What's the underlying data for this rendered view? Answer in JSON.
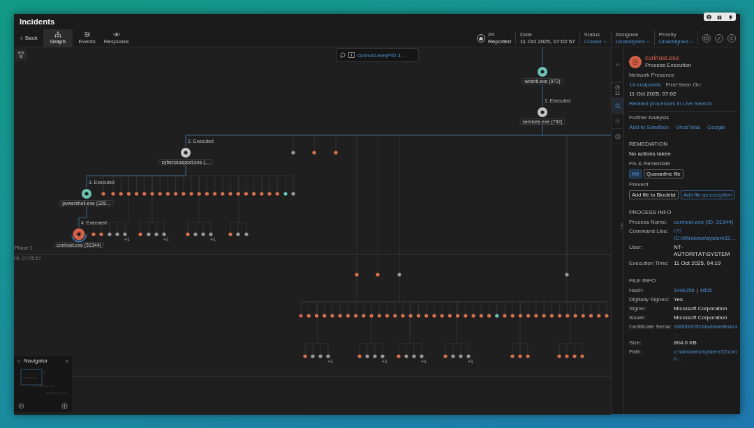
{
  "window": {
    "title": "Incidents"
  },
  "toolbar": {
    "back": "Back",
    "tabs": [
      {
        "label": "Graph",
        "selected": true
      },
      {
        "label": "Events",
        "selected": false
      },
      {
        "label": "Response",
        "selected": false
      }
    ]
  },
  "incident": {
    "number": "#9",
    "state": "Reported"
  },
  "fields": [
    {
      "label": "Date",
      "value": "11 Oct 2025, 07:02:57",
      "kind": "text"
    },
    {
      "label": "Status",
      "value": "Closed",
      "kind": "dropdown"
    },
    {
      "label": "Assignee",
      "value": "Unassigned",
      "kind": "dropdown"
    },
    {
      "label": "Priority",
      "value": "Unassigned",
      "kind": "dropdown"
    }
  ],
  "graph": {
    "search_link": "conhost.exe(PID 3…",
    "phase_label": "Phase 1",
    "timestamp": "05, 07:05:57",
    "navigator": "Navigator",
    "nodes": [
      {
        "label": "wininit.exe (972)",
        "color": "#6cc7b6",
        "selected": false
      },
      {
        "label": "services.exe (792)",
        "color": "#c9c9c9",
        "edge_label": "1. Executed",
        "selected": false
      },
      {
        "label": "cybercsuspect.exe (…",
        "color": "#c9c9c9",
        "edge_label": "2. Executed",
        "selected": false
      },
      {
        "label": "powershell.exe (328…",
        "color": "#6cc7b6",
        "edge_label": "3. Executed",
        "selected": false
      },
      {
        "label": "conhost.exe (31344)",
        "color": "#d3614a",
        "edge_label": "4. Executed",
        "selected": true
      }
    ],
    "dot_rows": [
      {
        "groups": [
          {
            "dots": [
              {
                "color": "#9b9b9b"
              },
              {
                "color": "#d9734e"
              },
              {
                "color": "#d9734e"
              }
            ]
          }
        ]
      },
      {
        "groups": [
          {
            "dots": [
              {
                "color": "#d9734e"
              },
              {
                "color": "#d9734e"
              },
              {
                "color": "#d9734e"
              },
              {
                "color": "#d9734e"
              },
              {
                "color": "#d9734e"
              },
              {
                "color": "#d9734e"
              },
              {
                "color": "#d9734e"
              },
              {
                "color": "#d9734e"
              },
              {
                "color": "#d9734e"
              },
              {
                "color": "#d9734e"
              },
              {
                "color": "#d9734e"
              },
              {
                "color": "#d9734e"
              },
              {
                "color": "#d9734e"
              },
              {
                "color": "#d9734e"
              },
              {
                "color": "#d9734e"
              },
              {
                "color": "#d9734e"
              },
              {
                "color": "#d9734e"
              },
              {
                "color": "#d9734e"
              },
              {
                "color": "#d9734e"
              },
              {
                "color": "#d9734e"
              },
              {
                "color": "#d9734e"
              },
              {
                "color": "#d9734e"
              },
              {
                "color": "#d9734e"
              },
              {
                "color": "#6cc7b6"
              },
              {
                "color": "#9b9b9b"
              }
            ]
          }
        ]
      },
      {
        "groups": [
          {
            "dots": [
              {
                "color": "#d9734e"
              },
              {
                "color": "#d9734e"
              },
              {
                "color": "#9b9b9b"
              },
              {
                "color": "#9b9b9b"
              },
              {
                "color": "#9b9b9b"
              }
            ],
            "more": "+1"
          },
          {
            "dots": [
              {
                "color": "#d9734e"
              },
              {
                "color": "#9b9b9b"
              },
              {
                "color": "#9b9b9b"
              },
              {
                "color": "#9b9b9b"
              }
            ],
            "more": "+1"
          },
          {
            "dots": [
              {
                "color": "#d9734e"
              },
              {
                "color": "#9b9b9b"
              },
              {
                "color": "#9b9b9b"
              },
              {
                "color": "#9b9b9b"
              }
            ],
            "more": "+1"
          },
          {
            "dots": [
              {
                "color": "#d9734e"
              },
              {
                "color": "#9b9b9b"
              },
              {
                "color": "#9b9b9b"
              }
            ]
          }
        ]
      },
      {
        "groups": [
          {
            "dots": [
              {
                "color": "#d9734e"
              },
              {
                "color": "#d9734e"
              },
              {
                "color": "#9b9b9b"
              },
              {
                "color": "#9b9b9b"
              }
            ]
          }
        ]
      },
      {
        "groups": [
          {
            "dots": [
              {
                "color": "#c8654a"
              },
              {
                "color": "#d9734e"
              },
              {
                "color": "#d9734e"
              },
              {
                "color": "#d9734e"
              },
              {
                "color": "#d9734e"
              },
              {
                "color": "#d9734e"
              },
              {
                "color": "#d9734e"
              },
              {
                "color": "#d9734e"
              },
              {
                "color": "#d9734e"
              },
              {
                "color": "#d9734e"
              },
              {
                "color": "#d9734e"
              },
              {
                "color": "#d9734e"
              },
              {
                "color": "#d9734e"
              },
              {
                "color": "#d9734e"
              },
              {
                "color": "#d9734e"
              },
              {
                "color": "#d9734e"
              },
              {
                "color": "#d9734e"
              },
              {
                "color": "#d9734e"
              },
              {
                "color": "#d9734e"
              },
              {
                "color": "#d9734e"
              },
              {
                "color": "#d9734e"
              },
              {
                "color": "#d9734e"
              },
              {
                "color": "#d9734e"
              },
              {
                "color": "#d9734e"
              },
              {
                "color": "#d9734e"
              },
              {
                "color": "#6cc7b6"
              },
              {
                "color": "#d9734e"
              },
              {
                "color": "#d9734e"
              },
              {
                "color": "#d9734e"
              },
              {
                "color": "#d9734e"
              },
              {
                "color": "#d9734e"
              },
              {
                "color": "#d9734e"
              },
              {
                "color": "#d9734e"
              },
              {
                "color": "#d9734e"
              },
              {
                "color": "#d9734e"
              },
              {
                "color": "#d9734e"
              },
              {
                "color": "#d9734e"
              },
              {
                "color": "#d9734e"
              },
              {
                "color": "#d9734e"
              },
              {
                "color": "#d9734e"
              }
            ]
          }
        ]
      },
      {
        "groups": [
          {
            "dots": [
              {
                "color": "#d9734e"
              },
              {
                "color": "#9b9b9b"
              },
              {
                "color": "#9b9b9b"
              },
              {
                "color": "#9b9b9b"
              }
            ],
            "more": "+1"
          },
          {
            "dots": [
              {
                "color": "#d9734e"
              },
              {
                "color": "#9b9b9b"
              },
              {
                "color": "#9b9b9b"
              },
              {
                "color": "#9b9b9b"
              }
            ],
            "more": "+1"
          },
          {
            "dots": [
              {
                "color": "#d9734e"
              },
              {
                "color": "#9b9b9b"
              },
              {
                "color": "#9b9b9b"
              },
              {
                "color": "#9b9b9b"
              }
            ],
            "more": "+1"
          },
          {
            "dots": [
              {
                "color": "#d9734e"
              },
              {
                "color": "#9b9b9b"
              },
              {
                "color": "#9b9b9b"
              },
              {
                "color": "#9b9b9b"
              }
            ],
            "more": "+1"
          },
          {
            "dots": [
              {
                "color": "#d9734e"
              },
              {
                "color": "#d9734e"
              },
              {
                "color": "#d9734e"
              }
            ]
          },
          {
            "dots": [
              {
                "color": "#d9734e"
              },
              {
                "color": "#d9734e"
              },
              {
                "color": "#d9734e"
              },
              {
                "color": "#d9734e"
              }
            ]
          }
        ]
      }
    ]
  },
  "side_tabs": [
    {
      "kind": "clock",
      "count": "11",
      "selected": false
    },
    {
      "kind": "search",
      "selected": true
    },
    {
      "kind": "plus",
      "selected": false
    },
    {
      "kind": "info",
      "selected": false
    }
  ],
  "details": {
    "name": "conhost.exe",
    "subtitle": "Process Execution",
    "network": {
      "heading": "Network Presence",
      "endpoints": "14 endpoints",
      "first_seen_label": "First Seen On:",
      "first_seen": "11 Oct 2025, 07:02",
      "related": "Related processes in Live Search"
    },
    "analysis": {
      "heading": "Further Analysis",
      "links": [
        "Add to Sandbox",
        "VirusTotal",
        "Google"
      ]
    },
    "remediation": {
      "heading": "REMEDIATION",
      "status": "No actions taken",
      "fix_heading": "Fix & Remediate",
      "fix_buttons": [
        {
          "label": "Kill",
          "kind": "primary"
        },
        {
          "label": "Quarantine file",
          "kind": "outline"
        }
      ],
      "prevent_heading": "Prevent",
      "prevent_buttons": [
        {
          "label": "Add file to Blocklist",
          "kind": "outline"
        },
        {
          "label": "Add file as exception",
          "kind": "accent"
        }
      ]
    },
    "process_info": {
      "heading": "PROCESS INFO",
      "rows": [
        {
          "label": "Process Name:",
          "value": "conhost.exe (ID: 31344)",
          "link": true
        },
        {
          "label": "Command Line:",
          "value": "\\??\\C:\\Windows\\system32…",
          "link": true
        },
        {
          "label": "User:",
          "value": "NT-AUTORITÄT\\SYSTEM",
          "link": false
        },
        {
          "label": "Execution Time:",
          "value": "11 Oct 2025, 04:19",
          "link": false
        }
      ]
    },
    "file_info": {
      "heading": "FILE INFO",
      "hash": {
        "label": "Hash:",
        "links": [
          "SHA256",
          "MD5"
        ],
        "separator": "|"
      },
      "rows": [
        {
          "label": "Digitally Signed:",
          "value": "Yes",
          "link": false
        },
        {
          "label": "Signer:",
          "value": "Microsoft Corporation",
          "link": false
        },
        {
          "label": "Issuer:",
          "value": "Microsoft Corporation",
          "link": false
        },
        {
          "label": "Certificate Serial:",
          "value": "330000051fdaddae8bdc4…",
          "link": true
        },
        {
          "label": "Size:",
          "value": "804.0 KB",
          "link": false
        },
        {
          "label": "Path:",
          "value": "c:\\windows\\system32\\conh…",
          "link": true
        }
      ]
    }
  }
}
